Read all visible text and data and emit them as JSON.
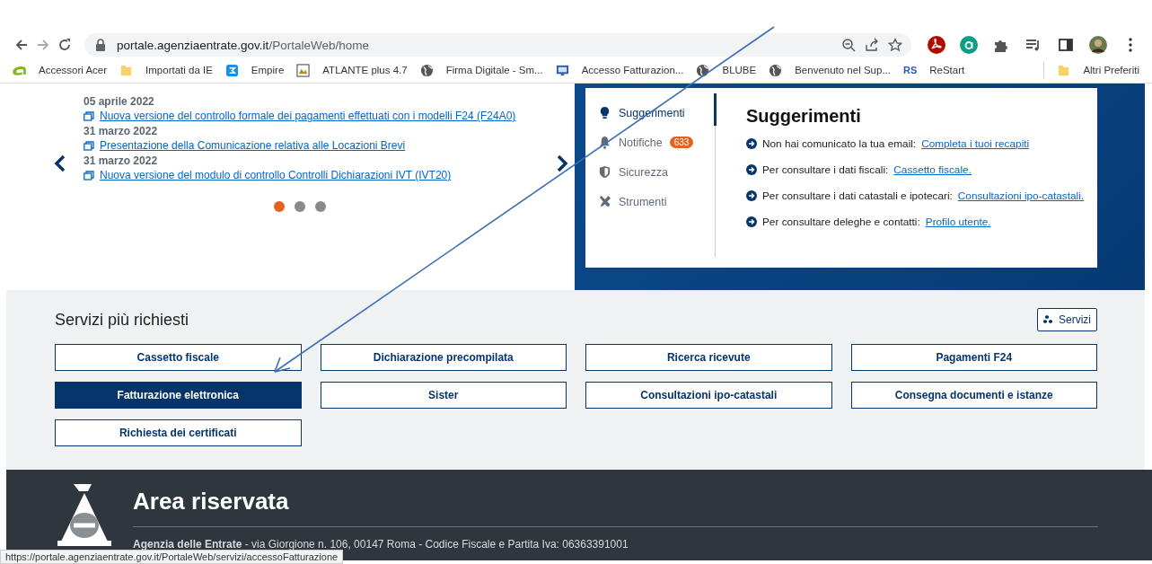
{
  "browser": {
    "address": {
      "host": "portale.agenziaentrate.gov.it",
      "path": "/PortaleWeb/home"
    },
    "bookmarks": [
      {
        "label": "Accessori Acer",
        "kind": "acer"
      },
      {
        "label": "Importati da IE",
        "kind": "folder"
      },
      {
        "label": "Empire",
        "kind": "app"
      },
      {
        "label": "ATLANTE plus 4.7",
        "kind": "image"
      },
      {
        "label": "Firma Digitale - Sm...",
        "kind": "globe"
      },
      {
        "label": "Accesso Fatturazion...",
        "kind": "screen"
      },
      {
        "label": "BLUBE",
        "kind": "globe"
      },
      {
        "label": "Benvenuto nel Sup...",
        "kind": "globe"
      },
      {
        "label": "ReStart",
        "kind": "badge",
        "badge": "RS"
      }
    ],
    "other_bookmarks": "Altri Preferiti"
  },
  "news": [
    {
      "date": "05 aprile 2022",
      "title": "Nuova versione del controllo formale dei pagamenti effettuati con i modelli F24 (F24A0)"
    },
    {
      "date": "31 marzo 2022",
      "title": "Presentazione della Comunicazione relativa alle Locazioni Brevi"
    },
    {
      "date": "31 marzo 2022",
      "title": "Nuova versione del modulo di controllo Controlli Dichiarazioni IVT (IVT20)"
    }
  ],
  "carousel_dots": [
    {
      "selected": true
    },
    {
      "selected": false
    },
    {
      "selected": false
    }
  ],
  "panel": {
    "tabs": [
      {
        "label": "Suggerimenti",
        "kind": "bulb",
        "selected": true
      },
      {
        "label": "Notifiche",
        "kind": "bell",
        "selected": false,
        "badge": "633"
      },
      {
        "label": "Sicurezza",
        "kind": "shield",
        "selected": false
      },
      {
        "label": "Strumenti",
        "kind": "tools",
        "selected": false
      }
    ],
    "title": "Suggerimenti",
    "tips": [
      {
        "text": "Non hai comunicato la tua email:",
        "link": "Completa i tuoi recapiti"
      },
      {
        "text": "Per consultare i dati fiscali:",
        "link": "Cassetto fiscale."
      },
      {
        "text": "Per consultare i dati catastali e ipotecari:",
        "link": "Consultazioni ipo-catastali."
      },
      {
        "text": "Per consultare deleghe e contatti:",
        "link": "Profilo utente."
      }
    ]
  },
  "services": {
    "title": "Servizi più richiesti",
    "all_button": "Servizi",
    "items": [
      {
        "label": "Cassetto fiscale",
        "selected": false
      },
      {
        "label": "Dichiarazione precompilata",
        "selected": false
      },
      {
        "label": "Ricerca ricevute",
        "selected": false
      },
      {
        "label": "Pagamenti F24",
        "selected": false
      },
      {
        "label": "Fatturazione elettronica",
        "selected": true
      },
      {
        "label": "Sister",
        "selected": false
      },
      {
        "label": "Consultazioni ipo-catastali",
        "selected": false
      },
      {
        "label": "Consegna documenti e istanze",
        "selected": false
      },
      {
        "label": "Richiesta dei certificati",
        "selected": false
      }
    ]
  },
  "footer": {
    "title": "Area riservata",
    "address": "**Agenzia delle Entrate** - via Giorgione n. 106, 00147 Roma - Codice Fiscale e Partita Iva: 06363391001"
  },
  "status_bar": {
    "url": "https://portale.agenziaentrate.gov.it/PortaleWeb/servizi/accessoFatturazione"
  }
}
